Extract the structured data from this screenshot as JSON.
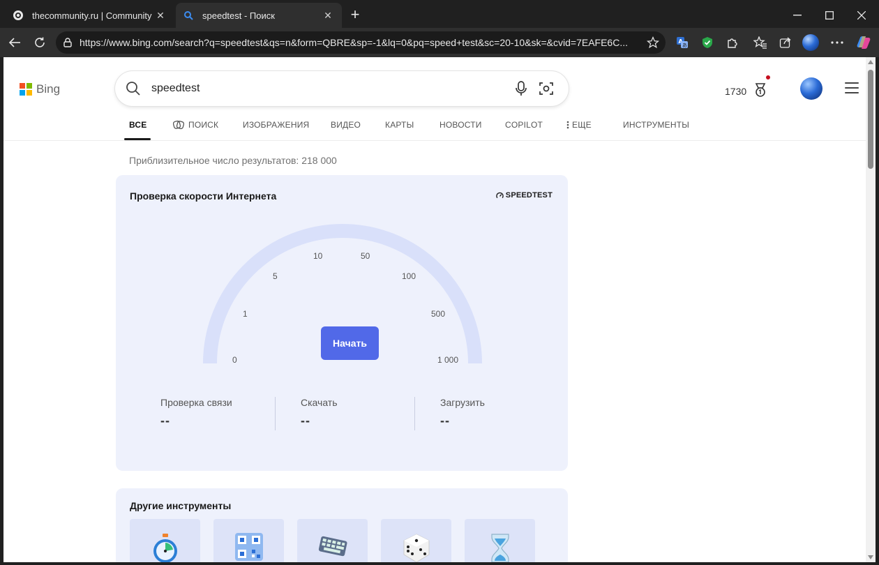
{
  "browser": {
    "tabs": [
      {
        "title": "thecommunity.ru | Community",
        "icon": "globe-icon",
        "active": false
      },
      {
        "title": "speedtest - Поиск",
        "icon": "bing-search-icon",
        "active": true
      }
    ],
    "url": "https://www.bing.com/search?q=speedtest&qs=n&form=QBRE&sp=-1&lq=0&pq=speed+test&sc=20-10&sk=&cvid=7EAFE6C..."
  },
  "bing": {
    "logo_text": "Bing",
    "query": "speedtest",
    "rewards_points": "1730"
  },
  "scopes": [
    {
      "label": "ВСЕ",
      "active": true
    },
    {
      "label": "ПОИСК",
      "active": false
    },
    {
      "label": "ИЗОБРАЖЕНИЯ",
      "active": false
    },
    {
      "label": "ВИДЕО",
      "active": false
    },
    {
      "label": "КАРТЫ",
      "active": false
    },
    {
      "label": "НОВОСТИ",
      "active": false
    },
    {
      "label": "COPILOT",
      "active": false
    },
    {
      "label": "ЕЩЕ",
      "active": false
    },
    {
      "label": "ИНСТРУМЕНТЫ",
      "active": false
    }
  ],
  "result_count": "Приблизительное число результатов: 218 000",
  "speedtest": {
    "title": "Проверка скорости Интернета",
    "brand": "SPEEDTEST",
    "ticks": [
      "0",
      "1",
      "5",
      "10",
      "50",
      "100",
      "500",
      "1 000"
    ],
    "start_label": "Начать",
    "metrics": [
      {
        "label": "Проверка связи",
        "value": "--"
      },
      {
        "label": "Скачать",
        "value": "--"
      },
      {
        "label": "Загрузить",
        "value": "--"
      }
    ]
  },
  "other_tools": {
    "title": "Другие инструменты",
    "tiles": [
      "stopwatch-icon",
      "qr-code-icon",
      "keyboard-icon",
      "dice-icon",
      "hourglass-icon"
    ]
  },
  "colors": {
    "accent": "#5169e8",
    "card_bg": "#eef1fc",
    "gauge_track": "#d9e0fa"
  }
}
